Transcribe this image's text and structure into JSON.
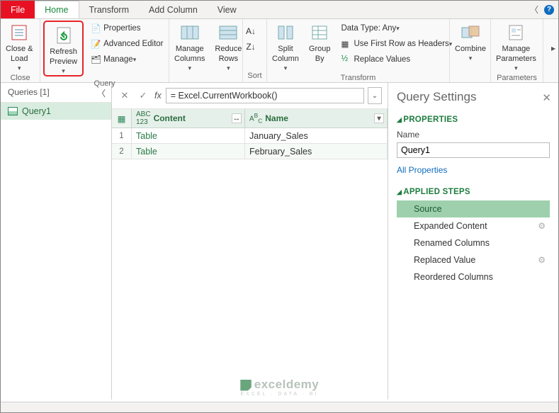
{
  "tabs": {
    "file": "File",
    "home": "Home",
    "transform": "Transform",
    "addcol": "Add Column",
    "view": "View"
  },
  "ribbon": {
    "close_load": "Close &\nLoad",
    "close_grp": "Close",
    "refresh": "Refresh\nPreview",
    "properties": "Properties",
    "adv_editor": "Advanced Editor",
    "manage": "Manage",
    "query_grp": "Query",
    "manage_cols": "Manage\nColumns",
    "reduce_rows": "Reduce\nRows",
    "sort_grp": "Sort",
    "split_col": "Split\nColumn",
    "group_by": "Group\nBy",
    "datatype": "Data Type: Any",
    "first_row": "Use First Row as Headers",
    "replace": "Replace Values",
    "transform_grp": "Transform",
    "combine": "Combine",
    "manage_params": "Manage\nParameters",
    "params_grp": "Parameters"
  },
  "queries": {
    "header": "Queries [1]",
    "q1": "Query1"
  },
  "formula": "= Excel.CurrentWorkbook()",
  "grid": {
    "col1": "Content",
    "col2": "Name",
    "rows": [
      {
        "n": "1",
        "content": "Table",
        "name": "January_Sales"
      },
      {
        "n": "2",
        "content": "Table",
        "name": "February_Sales"
      }
    ]
  },
  "settings": {
    "title": "Query Settings",
    "props": "PROPERTIES",
    "name_lbl": "Name",
    "name_val": "Query1",
    "all_props": "All Properties",
    "applied": "APPLIED STEPS",
    "steps": [
      "Source",
      "Expanded Content",
      "Renamed Columns",
      "Replaced Value",
      "Reordered Columns"
    ]
  },
  "watermark": {
    "main": "exceldemy",
    "sub": "EXCEL · DATA · BI"
  }
}
